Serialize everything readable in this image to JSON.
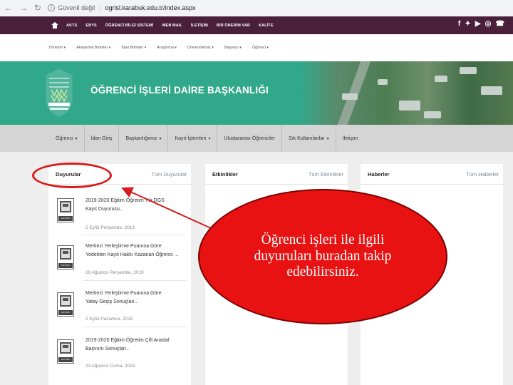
{
  "browser": {
    "security_label": "Güvenli değil",
    "url": "ogrisl.karabuk.edu.tr/index.aspx"
  },
  "topbar": {
    "links": [
      "AKTS",
      "EBYS",
      "ÖĞRENCİ BİLGİ SİSTEMİ",
      "WEB MAIL",
      "İLETİŞİM",
      "BİR ÖNERİM VAR",
      "KALİTE"
    ],
    "social": [
      "f",
      "✦",
      "▶",
      "◎",
      "☎"
    ]
  },
  "menu": [
    "Yönetim",
    "Akademik Birimler",
    "İdari Birimler",
    "Araştırma",
    "Üniversitemiz",
    "Başvuru",
    "Öğrenci"
  ],
  "banner": {
    "title": "ÖĞRENCİ İŞLERİ DAİRE BAŞKANLIĞI",
    "logo_text": "KARABÜK ÜNİVERSİTESİ"
  },
  "subnav": [
    {
      "label": "Öğrenci",
      "dropdown": true
    },
    {
      "label": "İdari Giriş",
      "dropdown": false
    },
    {
      "label": "Başkanlığımız",
      "dropdown": true
    },
    {
      "label": "Kayıt İşlemleri",
      "dropdown": true
    },
    {
      "label": "Uluslararası Öğrenciler",
      "dropdown": false
    },
    {
      "label": "Sık Kullanılanlar",
      "dropdown": true
    },
    {
      "label": "İletişim",
      "dropdown": false
    }
  ],
  "panels": {
    "announcements": {
      "title": "Duyurular",
      "link": "Tüm Duyurular",
      "icon_label": "DUYURU",
      "items": [
        {
          "line1": "2019-2020 Eğitim Öğretim Yılı DGS",
          "line2": "Kayıt Duyurusu..",
          "date": "5 Eylül Perşembe, 2019"
        },
        {
          "line1": "Merkezi Yerleştirme Puanına Göre",
          "line2": "Yedekten Kayıt Hakkı Kazanan Öğrenci ...",
          "date": "29 Ağustos Perşembe, 2019"
        },
        {
          "line1": "Merkezi Yerleştirme Puanına Göre",
          "line2": "Yatay Geçiş Sonuçları..",
          "date": "2 Eylül Pazartesi, 2019"
        },
        {
          "line1": "2019-2020 Eğitim Öğretim Çift Anadal",
          "line2": "Başvuru Sonuçları..",
          "date": "23 Ağustos Cuma, 2019"
        }
      ]
    },
    "events": {
      "title": "Etkinlikler",
      "link": "Tüm Etkinlikler"
    },
    "news": {
      "title": "Haberler",
      "link": "Tüm Haberler"
    }
  },
  "callout": {
    "text": "Öğrenci işleri ile ilgili duyuruları buradan takip edebilirsiniz.",
    "color": "#e81212"
  }
}
